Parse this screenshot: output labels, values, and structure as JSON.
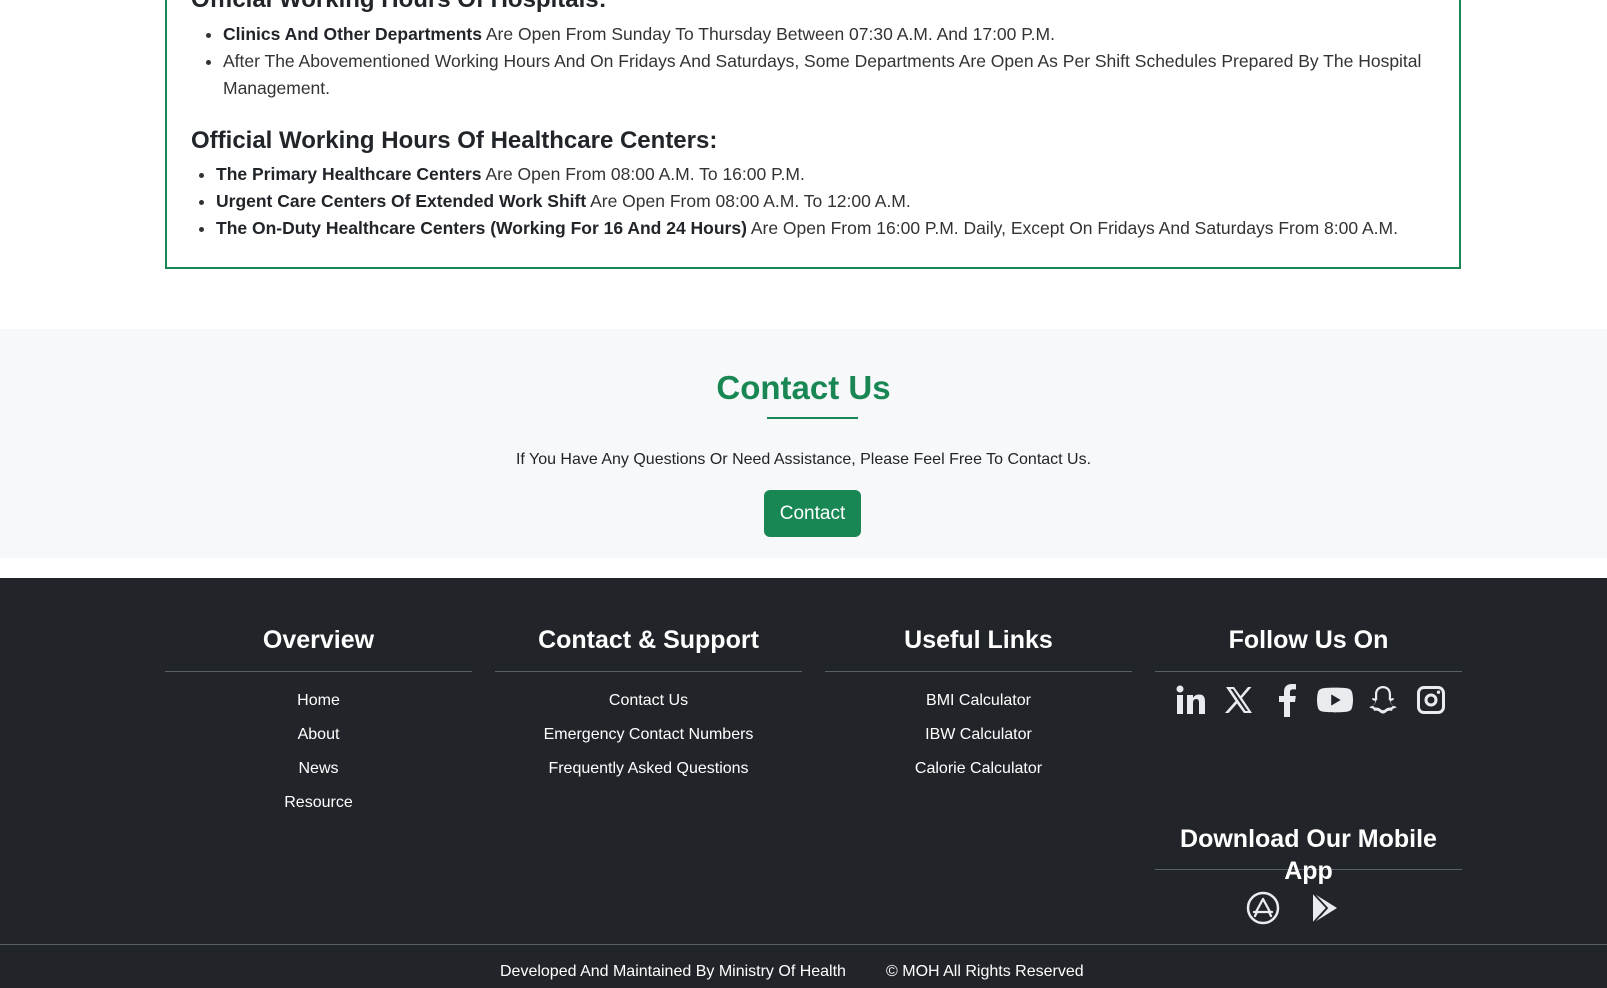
{
  "hours": {
    "hospitals_title": "Official Working Hours Of Hospitals:",
    "hospital_items": [
      {
        "bold": "Clinics And Other Departments",
        "text": " Are Open From Sunday To Thursday Between 07:30 A.M. And 17:00 P.M."
      },
      {
        "bold": "",
        "text": "After The Abovementioned Working Hours And On Fridays And Saturdays, Some Departments Are Open As Per Shift Schedules Prepared By The Hospital Management."
      }
    ],
    "healthcare_title": "Official Working Hours Of Healthcare Centers:",
    "healthcare_items": [
      {
        "bold": "The Primary Healthcare Centers",
        "text": " Are Open From 08:00 A.M. To 16:00 P.M."
      },
      {
        "bold": "Urgent Care Centers Of Extended Work Shift",
        "text": " Are Open From 08:00 A.M. To 12:00 A.M."
      },
      {
        "bold": "The On-Duty Healthcare Centers (Working For 16 And 24 Hours)",
        "text": " Are Open From 16:00 P.M. Daily, Except On Fridays And Saturdays From 8:00 A.M."
      }
    ]
  },
  "contact": {
    "title": "Contact Us",
    "text": "If You Have Any Questions Or Need Assistance, Please Feel Free To Contact Us.",
    "button": "Contact"
  },
  "footer": {
    "overview": {
      "title": "Overview",
      "links": [
        "Home",
        "About",
        "News",
        "Resource"
      ]
    },
    "support": {
      "title": "Contact & Support",
      "links": [
        "Contact Us",
        "Emergency Contact Numbers",
        "Frequently Asked Questions"
      ]
    },
    "useful": {
      "title": "Useful Links",
      "links": [
        "BMI Calculator",
        "IBW Calculator",
        "Calorie Calculator"
      ]
    },
    "follow": {
      "title": "Follow Us On",
      "icons": [
        "linkedin-icon",
        "x-twitter-icon",
        "facebook-icon",
        "youtube-icon",
        "snapchat-icon",
        "instagram-icon"
      ]
    },
    "app": {
      "title": "Download Our Mobile App",
      "icons": [
        "app-store-icon",
        "google-play-icon"
      ]
    },
    "developed": "Developed And Maintained By Ministry Of Health",
    "copyright": "© MOH All Rights Reserved"
  },
  "colors": {
    "accent": "#198754",
    "footer_bg": "#212529",
    "section_bg": "#f7f8fa"
  }
}
